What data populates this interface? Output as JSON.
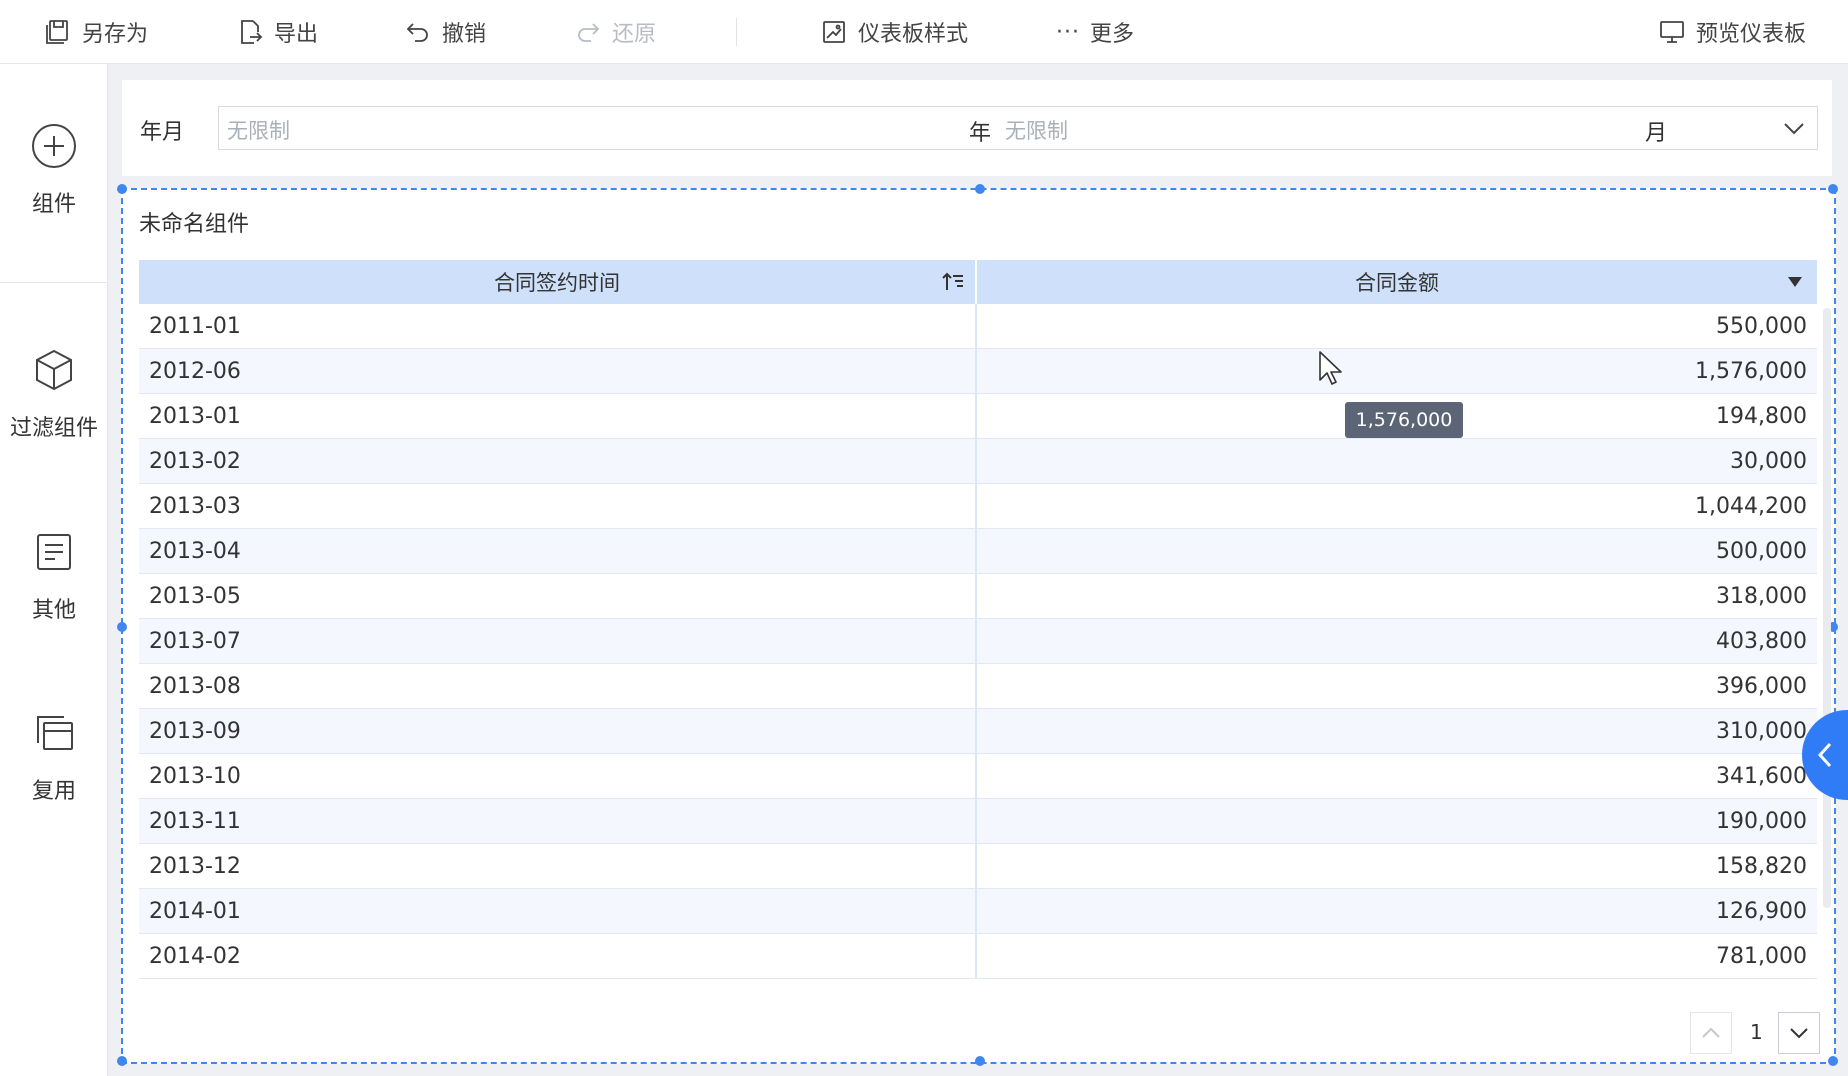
{
  "toolbar": {
    "save_as": "另存为",
    "export": "导出",
    "undo": "撤销",
    "redo": "还原",
    "dashboard_style": "仪表板样式",
    "more": "更多",
    "preview": "预览仪表板"
  },
  "sidebar": {
    "items": [
      {
        "label": "组件",
        "icon": "plus-circle-icon"
      },
      {
        "label": "过滤组件",
        "icon": "cube-icon"
      },
      {
        "label": "其他",
        "icon": "document-icon"
      },
      {
        "label": "复用",
        "icon": "copy-icon"
      }
    ]
  },
  "filter": {
    "label": "年月",
    "year_placeholder": "无限制",
    "year_unit": "年",
    "month_placeholder": "无限制",
    "month_unit": "月"
  },
  "widget": {
    "title": "未命名组件",
    "columns": [
      "合同签约时间",
      "合同金额"
    ],
    "rows": [
      [
        "2011-01",
        "550,000"
      ],
      [
        "2012-06",
        "1,576,000"
      ],
      [
        "2013-01",
        "194,800"
      ],
      [
        "2013-02",
        "30,000"
      ],
      [
        "2013-03",
        "1,044,200"
      ],
      [
        "2013-04",
        "500,000"
      ],
      [
        "2013-05",
        "318,000"
      ],
      [
        "2013-07",
        "403,800"
      ],
      [
        "2013-08",
        "396,000"
      ],
      [
        "2013-09",
        "310,000"
      ],
      [
        "2013-10",
        "341,600"
      ],
      [
        "2013-11",
        "190,000"
      ],
      [
        "2013-12",
        "158,820"
      ],
      [
        "2014-01",
        "126,900"
      ],
      [
        "2014-02",
        "781,000"
      ]
    ],
    "tooltip": "1,576,000",
    "page": "1"
  },
  "colors": {
    "accent": "#3f86f0",
    "header_bg": "#cfe0fb",
    "tab_blue": "#2f7cf6"
  }
}
